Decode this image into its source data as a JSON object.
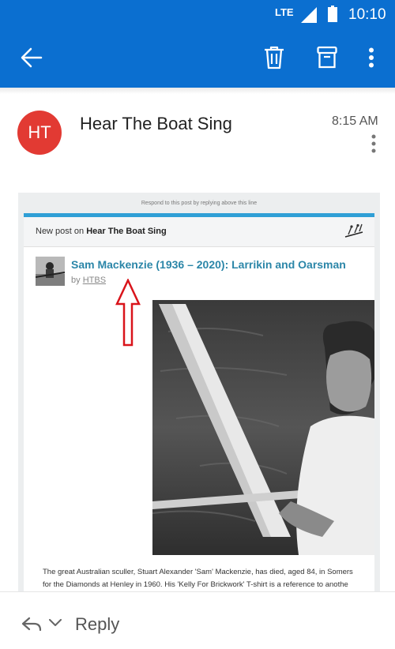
{
  "statusbar": {
    "network": "LTE",
    "time": "10:10"
  },
  "appbar": {
    "back_icon": "arrow-left-icon",
    "delete_icon": "trash-icon",
    "archive_icon": "archive-icon",
    "more_icon": "more-vert-icon"
  },
  "email": {
    "avatar_initials": "HT",
    "sender": "Hear The Boat Sing",
    "time": "8:15 AM"
  },
  "message": {
    "respond_line": "Respond to this post by replying above this line",
    "new_post_prefix": "New post on ",
    "blog_name": "Hear The Boat Sing",
    "post_title": "Sam Mackenzie (1936 – 2020): Larrikin and Oarsman",
    "byline_prefix": "by ",
    "author": "HTBS",
    "excerpt_line1": "The great Australian sculler, Stuart Alexander 'Sam' Mackenzie, has died, aged 84, in Somers",
    "excerpt_line2": "for the Diamonds at Henley in 1960. His 'Kelly For Brickwork' T-shirt is a reference to anothe"
  },
  "footer": {
    "reply_label": "Reply"
  },
  "colors": {
    "brand_blue": "#0b6fd0",
    "avatar_red": "#e23a33",
    "link_teal": "#2b86a8",
    "arrow_red": "#d9141b"
  }
}
